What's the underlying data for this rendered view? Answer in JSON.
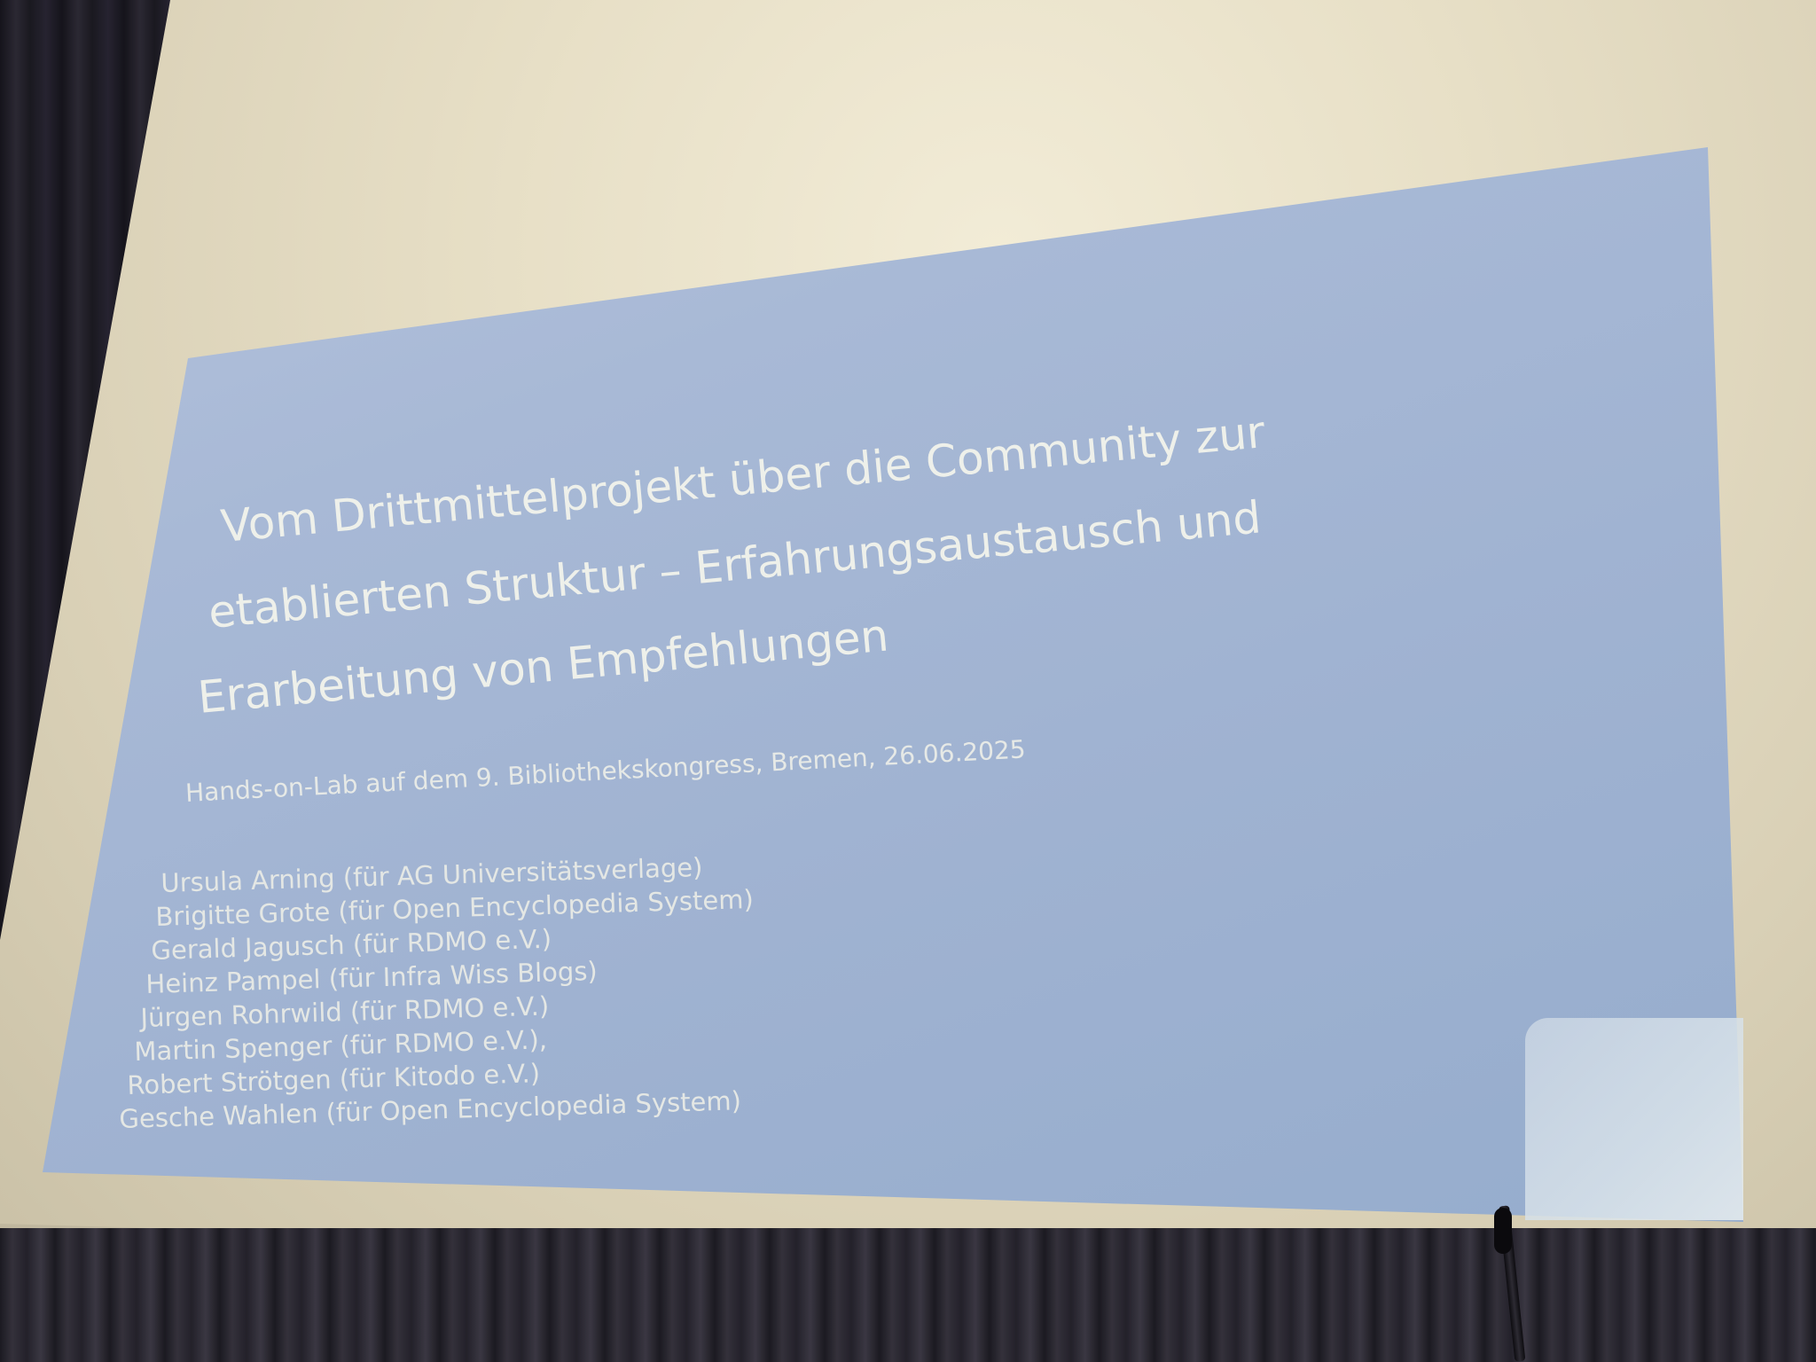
{
  "slide": {
    "title_lines": [
      "Vom Drittmittelprojekt über die Community zur",
      "etablierten Struktur –  Erfahrungsaustausch und",
      "Erarbeitung von Empfehlungen"
    ],
    "subtitle": "Hands-on-Lab auf dem 9. Bibliothekskongress, Bremen, 26.06.2025",
    "authors": [
      "Ursula Arning (für AG Universitätsverlage)",
      "Brigitte Grote (für Open Encyclopedia System)",
      "Gerald Jagusch (für RDMO e.V.)",
      "Heinz Pampel (für Infra Wiss Blogs)",
      "Jürgen Rohrwild (für RDMO e.V.)",
      "Martin Spenger (für RDMO e.V.),",
      "Robert Strötgen (für Kitodo e.V.)",
      "Gesche Wahlen (für Open Encyclopedia System)"
    ]
  },
  "colors": {
    "slide_background": "#a8b9d6",
    "slide_text": "#eef0ea",
    "screen": "#e7dfc6",
    "curtain": "#1d1b23"
  }
}
